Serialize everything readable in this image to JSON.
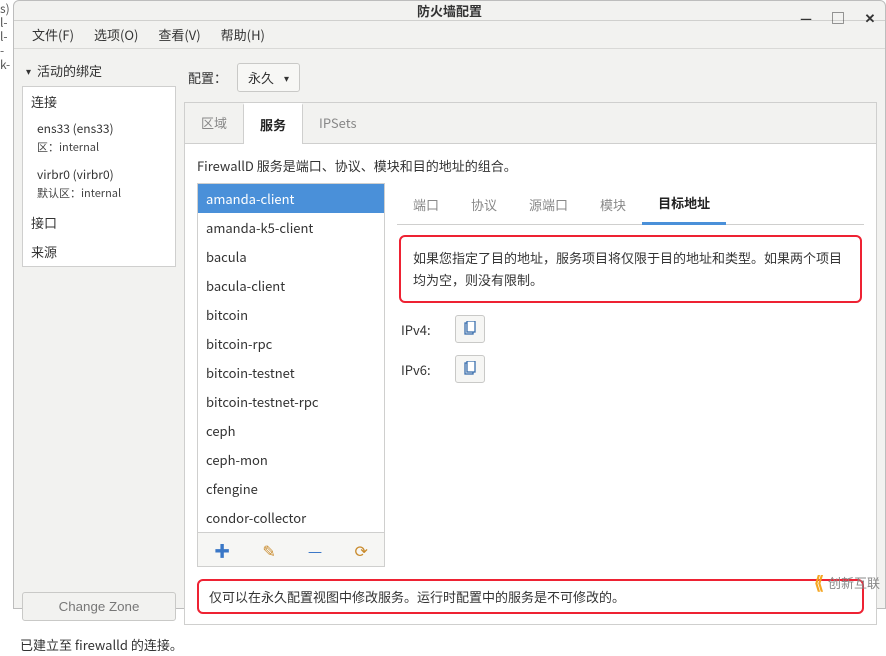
{
  "left_gutter": [
    "s)",
    "l-",
    "l-",
    "-",
    "k-"
  ],
  "window": {
    "title": "防火墙配置",
    "controls": {
      "minimize": "—",
      "maximize": "▢",
      "close": "✕"
    }
  },
  "menubar": [
    {
      "label": "文件(F)"
    },
    {
      "label": "选项(O)"
    },
    {
      "label": "查看(V)"
    },
    {
      "label": "帮助(H)"
    }
  ],
  "sidebar": {
    "heading": "活动的绑定",
    "sections": {
      "connections": {
        "label": "连接",
        "hosts": [
          {
            "name": "ens33 (ens33)",
            "zone": "区：internal"
          },
          {
            "name": "virbr0 (virbr0)",
            "zone": "默认区：internal"
          }
        ]
      },
      "interfaces": {
        "label": "接口"
      },
      "sources": {
        "label": "来源"
      }
    },
    "change_zone": "Change Zone"
  },
  "config_label": "配置：",
  "config_value": "永久",
  "outer_tabs": [
    {
      "label": "区域",
      "active": false
    },
    {
      "label": "服务",
      "active": true
    },
    {
      "label": "IPSets",
      "active": false
    }
  ],
  "description": "FirewallD 服务是端口、协议、模块和目的地址的组合。",
  "services": [
    "amanda-client",
    "amanda-k5-client",
    "bacula",
    "bacula-client",
    "bitcoin",
    "bitcoin-rpc",
    "bitcoin-testnet",
    "bitcoin-testnet-rpc",
    "ceph",
    "ceph-mon",
    "cfengine",
    "condor-collector"
  ],
  "service_selected": 0,
  "service_toolbar": {
    "add": "✚",
    "edit": "✎",
    "remove": "—",
    "reload": "⟳"
  },
  "subtabs": [
    {
      "label": "端口",
      "active": false
    },
    {
      "label": "协议",
      "active": false
    },
    {
      "label": "源端口",
      "active": false
    },
    {
      "label": "模块",
      "active": false
    },
    {
      "label": "目标地址",
      "active": true
    }
  ],
  "target_help": "如果您指定了目的地址，服务项目将仅限于目的地址和类型。如果两个项目均为空，则没有限制。",
  "ipv4_label": "IPv4:",
  "ipv6_label": "IPv6:",
  "footer_note": "仅可以在永久配置视图中修改服务。运行时配置中的服务是不可修改的。",
  "status": "已建立至 firewalld 的连接。",
  "watermark": "创新互联"
}
